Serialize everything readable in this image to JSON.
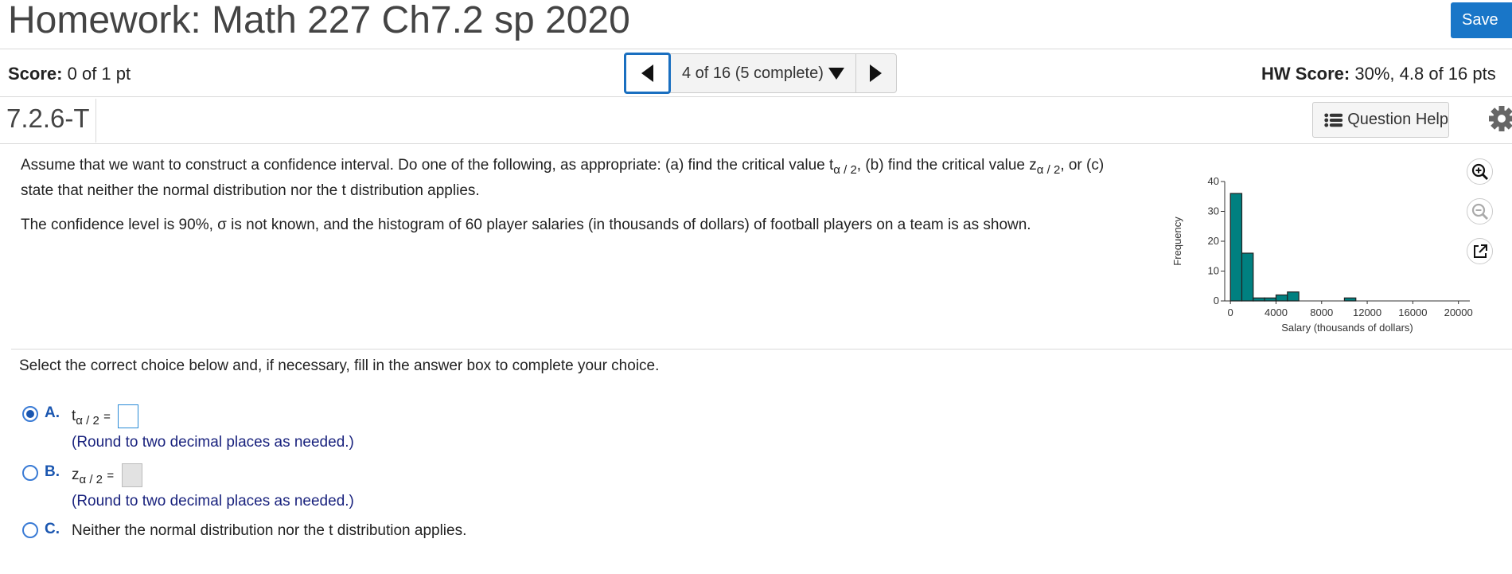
{
  "header": {
    "title": "Homework: Math 227 Ch7.2 sp 2020",
    "save_label": "Save"
  },
  "score_bar": {
    "score_label": "Score:",
    "score_value": "0 of 1 pt",
    "navigator_text": "4 of 16 (5 complete)",
    "hw_score_label": "HW Score:",
    "hw_score_value": "30%, 4.8 of 16 pts"
  },
  "question": {
    "id": "7.2.6-T",
    "help_label": "Question Help",
    "line1_part1": "Assume that we want to construct a confidence interval. Do one of the following, as appropriate: (a) find the critical value t",
    "sub_alpha2": "α / 2",
    "line1_part2": ", (b) find the critical value z",
    "line1_part3": ", or (c)",
    "line2": "state that neither the normal distribution nor the t distribution applies.",
    "line3": "The confidence level is 90%, σ is not known, and the histogram of 60 player salaries (in thousands of dollars) of football players on a team is as shown.",
    "select_prompt": "Select the correct choice below and, if necessary, fill in the answer box to complete your choice."
  },
  "options": [
    {
      "letter": "A.",
      "var": "t",
      "sub": "α / 2",
      "eq": "=",
      "hint": "(Round to two decimal places as needed.)",
      "selected": true
    },
    {
      "letter": "B.",
      "var": "z",
      "sub": "α / 2",
      "eq": "=",
      "hint": "(Round to two decimal places as needed.)",
      "selected": false
    },
    {
      "letter": "C.",
      "text": "Neither the normal distribution nor the t distribution applies.",
      "selected": false
    }
  ],
  "icons": [
    "chevron-left-icon",
    "caret-down-icon",
    "chevron-right-icon",
    "list-icon",
    "gear-icon",
    "zoom-in-icon",
    "zoom-out-icon",
    "popout-icon"
  ],
  "colors": {
    "accent": "#1976c8",
    "bar_fill": "#008080",
    "hint": "#1a237e"
  },
  "chart_data": {
    "type": "bar",
    "ylabel": "Frequency",
    "xlabel": "Salary (thousands of dollars)",
    "bin_width": 1000,
    "bin_starts": [
      0,
      1000,
      2000,
      3000,
      4000,
      5000,
      6000,
      7000,
      8000,
      9000,
      10000,
      11000,
      12000,
      13000,
      14000,
      15000,
      16000,
      17000,
      18000,
      19000,
      20000
    ],
    "values": [
      36,
      16,
      1,
      1,
      2,
      3,
      0,
      0,
      0,
      0,
      1
    ],
    "xlim": [
      -500,
      21000
    ],
    "ylim": [
      0,
      40
    ],
    "x_ticks": [
      "0",
      "4000",
      "8000",
      "12000",
      "16000",
      "20000"
    ],
    "y_ticks": [
      "0",
      "10",
      "20",
      "30",
      "40"
    ],
    "bar_color": "#008080"
  }
}
